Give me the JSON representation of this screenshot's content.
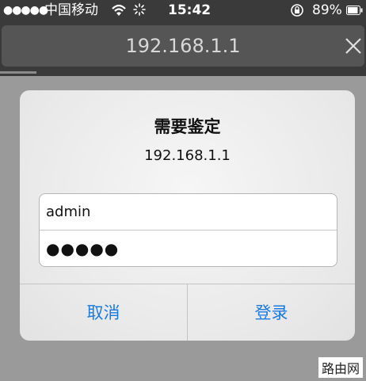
{
  "status_bar": {
    "signal": "●●●●●",
    "carrier": "中国移动",
    "time": "15:42",
    "battery_percent": "89%",
    "battery_level": 0.89
  },
  "browser": {
    "address": "192.168.1.1",
    "load_progress": 0.1
  },
  "auth_dialog": {
    "title": "需要鉴定",
    "message": "192.168.1.1",
    "username_value": "admin",
    "password_value": "●●●●●",
    "cancel_label": "取消",
    "login_label": "登录",
    "accent_color": "#1a7ae0"
  },
  "watermark": "路由网"
}
